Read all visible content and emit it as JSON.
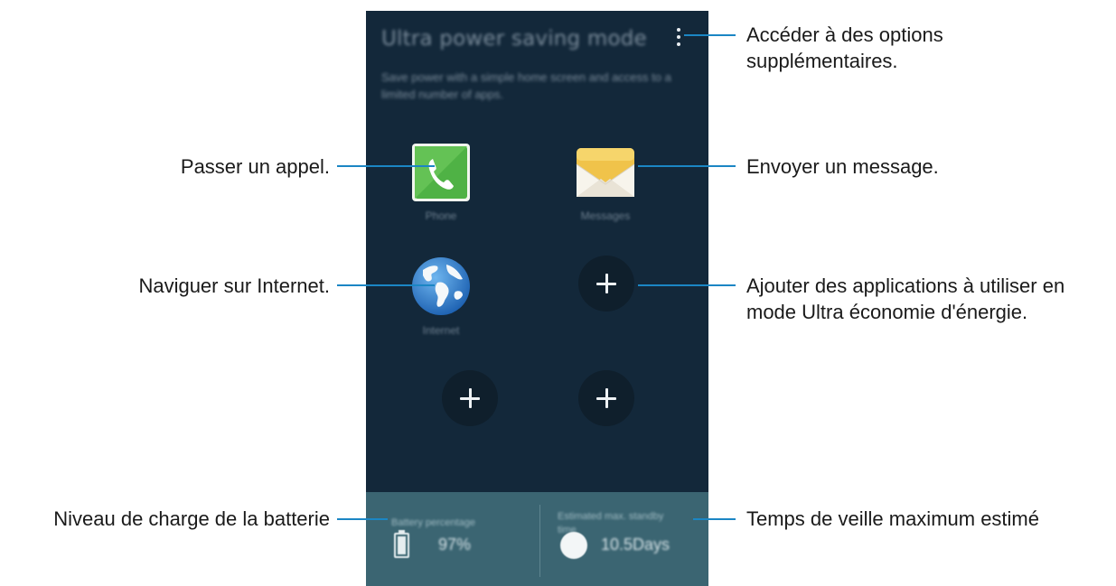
{
  "screen": {
    "title": "Ultra power saving mode",
    "description": "Save power with a simple home screen and access to a limited number of apps.",
    "apps": [
      {
        "label": "Phone",
        "icon": "phone-icon"
      },
      {
        "label": "Messages",
        "icon": "messages-icon"
      },
      {
        "label": "Internet",
        "icon": "internet-globe-icon"
      }
    ],
    "battery": {
      "label": "Battery percentage",
      "value": "97%"
    },
    "standby": {
      "label": "Estimated max. standby time",
      "value": "10.5Days"
    }
  },
  "callouts": {
    "more_options": "Accéder à des options supplémentaires.",
    "call": "Passer un appel.",
    "message": "Envoyer un message.",
    "internet": "Naviguer sur Internet.",
    "add_apps": "Ajouter des applications à utiliser en mode Ultra économie d'énergie.",
    "battery_level": "Niveau de charge de la batterie",
    "standby_time": "Temps de veille maximum estimé"
  },
  "colors": {
    "screen_bg": "#13283a",
    "panel_bg": "#3b6572",
    "callout_line": "#1b86c4"
  }
}
